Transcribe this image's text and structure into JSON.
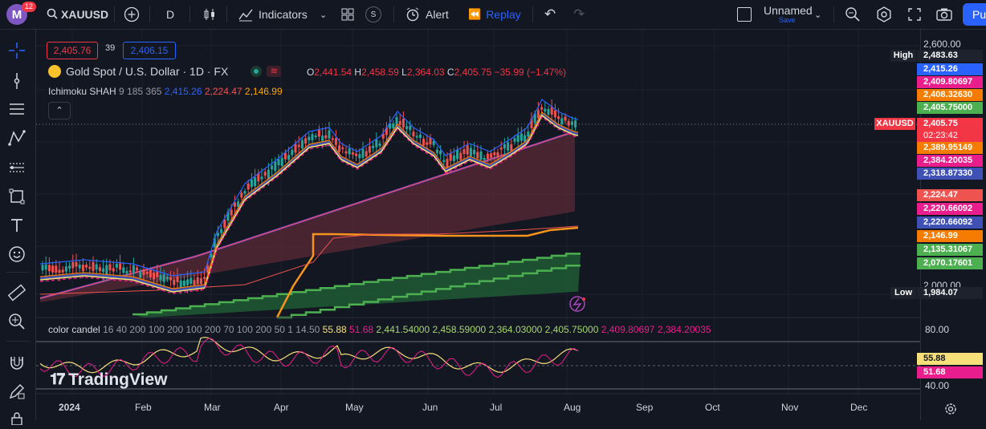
{
  "header": {
    "avatar_letter": "M",
    "notification_count": "12",
    "symbol": "XAUUSD",
    "interval": "D",
    "indicators_label": "Indicators",
    "alert_label": "Alert",
    "replay_label": "Replay",
    "layout_name": "Unnamed",
    "save_label": "Save",
    "publish_label": "Pu",
    "s_badge": "S"
  },
  "order_panel": {
    "sell_price": "2,405.76",
    "spread": "39",
    "buy_price": "2,406.15"
  },
  "legend": {
    "symbol_title": "Gold Spot / U.S. Dollar · 1D · FX",
    "o_label": "O",
    "o_value": "2,441.54",
    "h_label": "H",
    "h_value": "2,458.59",
    "l_label": "L",
    "l_value": "2,364.03",
    "c_label": "C",
    "c_value": "2,405.75",
    "change": "−35.99 (−1.47%)",
    "ichimoku_name": "Ichimoku SHAH",
    "ichimoku_params": "9 185 365",
    "ichimoku_v1": "2,415.26",
    "ichimoku_v2": "2,224.47",
    "ichimoku_v3": "2,146.99"
  },
  "oscillator": {
    "name": "color candel",
    "params": "16 40 200 100 200 100 200 70 100 200 50 1 14.50",
    "v1": "55.88",
    "v2": "51.68",
    "v3": "2,441.54000",
    "v4": "2,458.59000",
    "v5": "2,364.03000",
    "v6": "2,405.75000",
    "v7": "2,409.80697",
    "v8": "2,384.20035",
    "axis_top": "80.00",
    "axis_bottom": "40.00",
    "tag1": "55.88",
    "tag2": "51.68"
  },
  "price_axis": {
    "tick_top": "2,600.00",
    "tick_bottom": "2,000.00",
    "high_label": "High",
    "high_value": "2,483.63",
    "low_label": "Low",
    "low_value": "1,984.07",
    "symbol_tag": "XAUUSD",
    "last_price": "2,405.75",
    "countdown": "02:23:42",
    "tags": [
      {
        "value": "2,415.26",
        "color": "#2962ff"
      },
      {
        "value": "2,409.80697",
        "color": "#e91e8c"
      },
      {
        "value": "2,408.32630",
        "color": "#f57c00"
      },
      {
        "value": "2,405.75000",
        "color": "#4caf50"
      },
      {
        "value": "2,389.95149",
        "color": "#f57c00"
      },
      {
        "value": "2,384.20035",
        "color": "#e91e8c"
      },
      {
        "value": "2,318.87330",
        "color": "#3f51b5"
      },
      {
        "value": "2,224.47",
        "color": "#ef5350"
      },
      {
        "value": "2,220.66092",
        "color": "#e91e8c"
      },
      {
        "value": "2,220.66092",
        "color": "#3f51b5"
      },
      {
        "value": "2,146.99",
        "color": "#f57c00"
      },
      {
        "value": "2,135.31067",
        "color": "#4caf50"
      },
      {
        "value": "2,070.17601",
        "color": "#4caf50"
      }
    ]
  },
  "time_axis": [
    "2024",
    "Feb",
    "Mar",
    "Apr",
    "May",
    "Jun",
    "Jul",
    "Aug",
    "Sep",
    "Oct",
    "Nov",
    "Dec"
  ],
  "watermark": "TradingView",
  "colors": {
    "background": "#131722",
    "up": "#26a69a",
    "down": "#ef5350",
    "accent": "#2962ff"
  }
}
